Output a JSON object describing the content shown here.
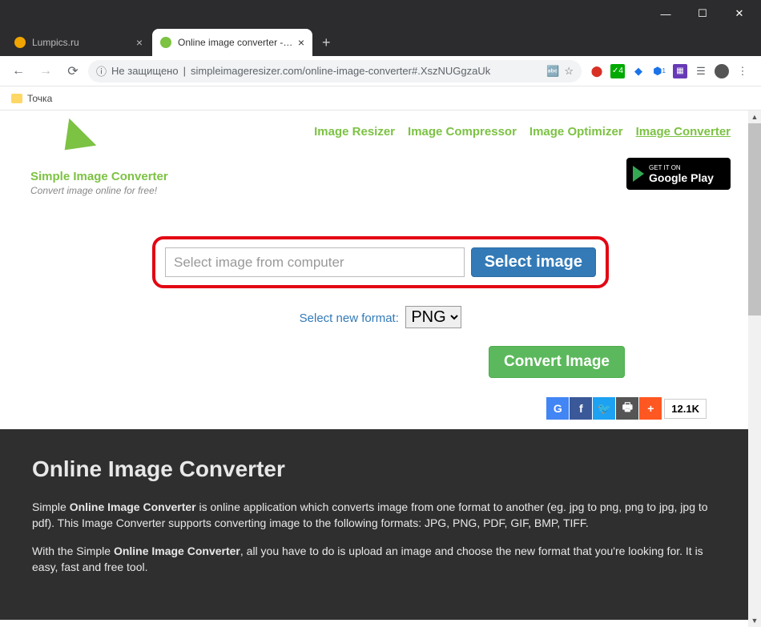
{
  "window": {
    "tabs": [
      {
        "title": "Lumpics.ru",
        "favColor": "#f0a500"
      },
      {
        "title": "Online image converter - online",
        "favColor": "#7cc243"
      }
    ]
  },
  "address": {
    "security": "Не защищено",
    "url": "simpleimageresizer.com/online-image-converter#.XszNUGgzaUk"
  },
  "bookmarks": {
    "item1": "Точка"
  },
  "logo": {
    "title": "Simple Image Converter",
    "subtitle": "Convert image online for free!"
  },
  "nav": {
    "link1": "Image Resizer",
    "link2": "Image Compressor",
    "link3": "Image Optimizer",
    "link4": "Image Converter"
  },
  "gplay": {
    "top": "GET IT ON",
    "main": "Google Play"
  },
  "upload": {
    "placeholder": "Select image from computer",
    "button": "Select image"
  },
  "format": {
    "label": "Select new format:",
    "selected": "PNG"
  },
  "convert": {
    "button": "Convert Image"
  },
  "share": {
    "count": "12.1K"
  },
  "section": {
    "heading": "Online Image Converter",
    "p1a": "Simple ",
    "p1b": "Online Image Converter",
    "p1c": " is online application which converts image from one format to another (eg. jpg to png, png to jpg, jpg to pdf). This Image Converter supports converting image to the following formats: JPG, PNG, PDF, GIF, BMP, TIFF.",
    "p2a": "With the Simple ",
    "p2b": "Online Image Converter",
    "p2c": ", all you have to do is upload an image and choose the new format that you're looking for. It is easy, fast and free tool."
  }
}
